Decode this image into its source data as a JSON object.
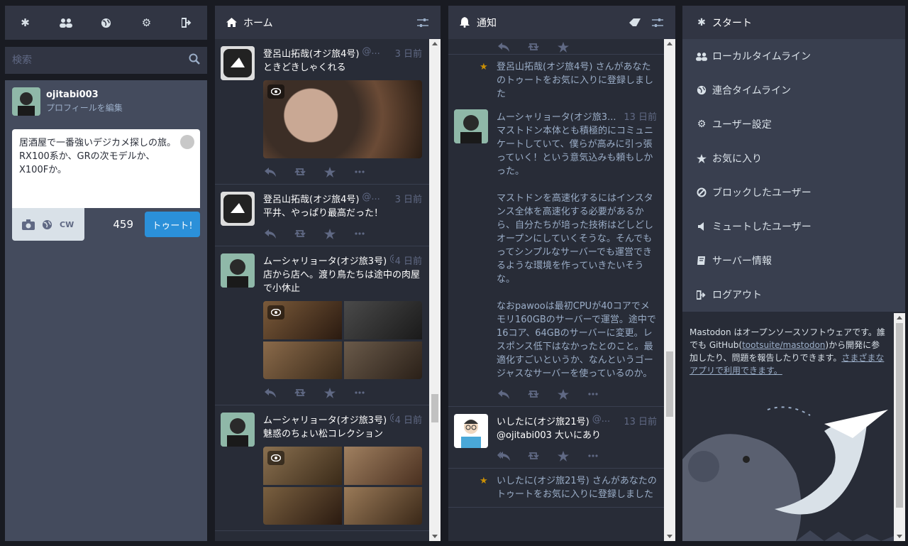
{
  "nav": {
    "icons": [
      "asterisk-icon",
      "people-icon",
      "globe-icon",
      "gear-icon",
      "logout-icon"
    ]
  },
  "search": {
    "placeholder": "検索"
  },
  "profile": {
    "username": "ojitabi003",
    "edit_link": "プロフィールを編集"
  },
  "compose": {
    "text_line1": "居酒屋で一番強いデジカメ探しの旅。",
    "text_line2": "RX100系か、GRの次モデルか、",
    "text_line3": "X100Fか。",
    "cw_label": "CW",
    "char_count": "459",
    "toot_label": "トゥート!"
  },
  "home": {
    "title": "ホーム",
    "statuses": [
      {
        "name": "登呂山拓哉(オジ旅4号)",
        "acct": "@...",
        "time": "3 日前",
        "content": "ときどきしゃくれる",
        "media": "one"
      },
      {
        "name": "登呂山拓哉(オジ旅4号)",
        "acct": "@...",
        "time": "3 日前",
        "content": "平井、やっぱり最高だった！",
        "media": "none"
      },
      {
        "name": "ムーシャリョータ(オジ旅3号)",
        "acct": "@...",
        "time": "4 日前",
        "content": "店から店へ。渡り鳥たちは途中の肉屋で小休止",
        "media": "four"
      },
      {
        "name": "ムーシャリョータ(オジ旅3号)",
        "acct": "@...",
        "time": "4 日前",
        "content": "魅惑のちょい松コレクション",
        "media": "four"
      }
    ]
  },
  "notifications": {
    "title": "通知",
    "fav_notice_1": "登呂山拓哉(オジ旅4号) さんがあなたのトゥートをお気に入りに登録しました",
    "boosted": {
      "name": "ムーシャリョータ(オジ旅3...",
      "time": "13 日前",
      "p1": "マストドン本体とも積極的にコミュニケートしていて、僕らが高みに引っ張っていく！という意気込みも頼もしかった。",
      "p2": "マストドンを高速化するにはインスタンス全体を高速化する必要があるから、自分たちが培った技術はどしどしオープンにしていくそうな。そんでもってシンプルなサーバーでも運営できるような環境を作っていきたいそうな。",
      "p3": "なおpawooは最初CPUが40コアでメモリ160GBのサーバーで運営。途中で16コア、64GBのサーバーに変更。レスポンス低下はなかったとのこと。最適化すごいというか、なんというゴージャスなサーバーを使っているのか。"
    },
    "reply": {
      "name": "いしたに(オジ旅21号)",
      "acct": "@...",
      "time": "13 日前",
      "content": "@ojitabi003 大いにあり"
    },
    "fav_notice_2": "いしたに(オジ旅21号) さんがあなたのトゥートをお気に入りに登録しました"
  },
  "start": {
    "title": "スタート",
    "items": [
      {
        "label": "ローカルタイムライン",
        "icon": "people-icon"
      },
      {
        "label": "連合タイムライン",
        "icon": "globe-icon"
      },
      {
        "label": "ユーザー設定",
        "icon": "gear-icon"
      },
      {
        "label": "お気に入り",
        "icon": "star-icon"
      },
      {
        "label": "ブロックしたユーザー",
        "icon": "ban-icon"
      },
      {
        "label": "ミュートしたユーザー",
        "icon": "volume-off-icon"
      },
      {
        "label": "サーバー情報",
        "icon": "book-icon"
      },
      {
        "label": "ログアウト",
        "icon": "logout-icon"
      }
    ],
    "about_prefix": "Mastodon はオープンソースソフトウェアです。誰でも GitHub(",
    "about_link": "tootsuite/mastodon",
    "about_mid": ")から開発に参加したり、問題を報告したりできます。",
    "about_link2": "さまざまなアプリで利用できます。"
  },
  "colors": {
    "accent": "#2b90d9",
    "star": "#ca8f04",
    "bg": "#282c37"
  }
}
